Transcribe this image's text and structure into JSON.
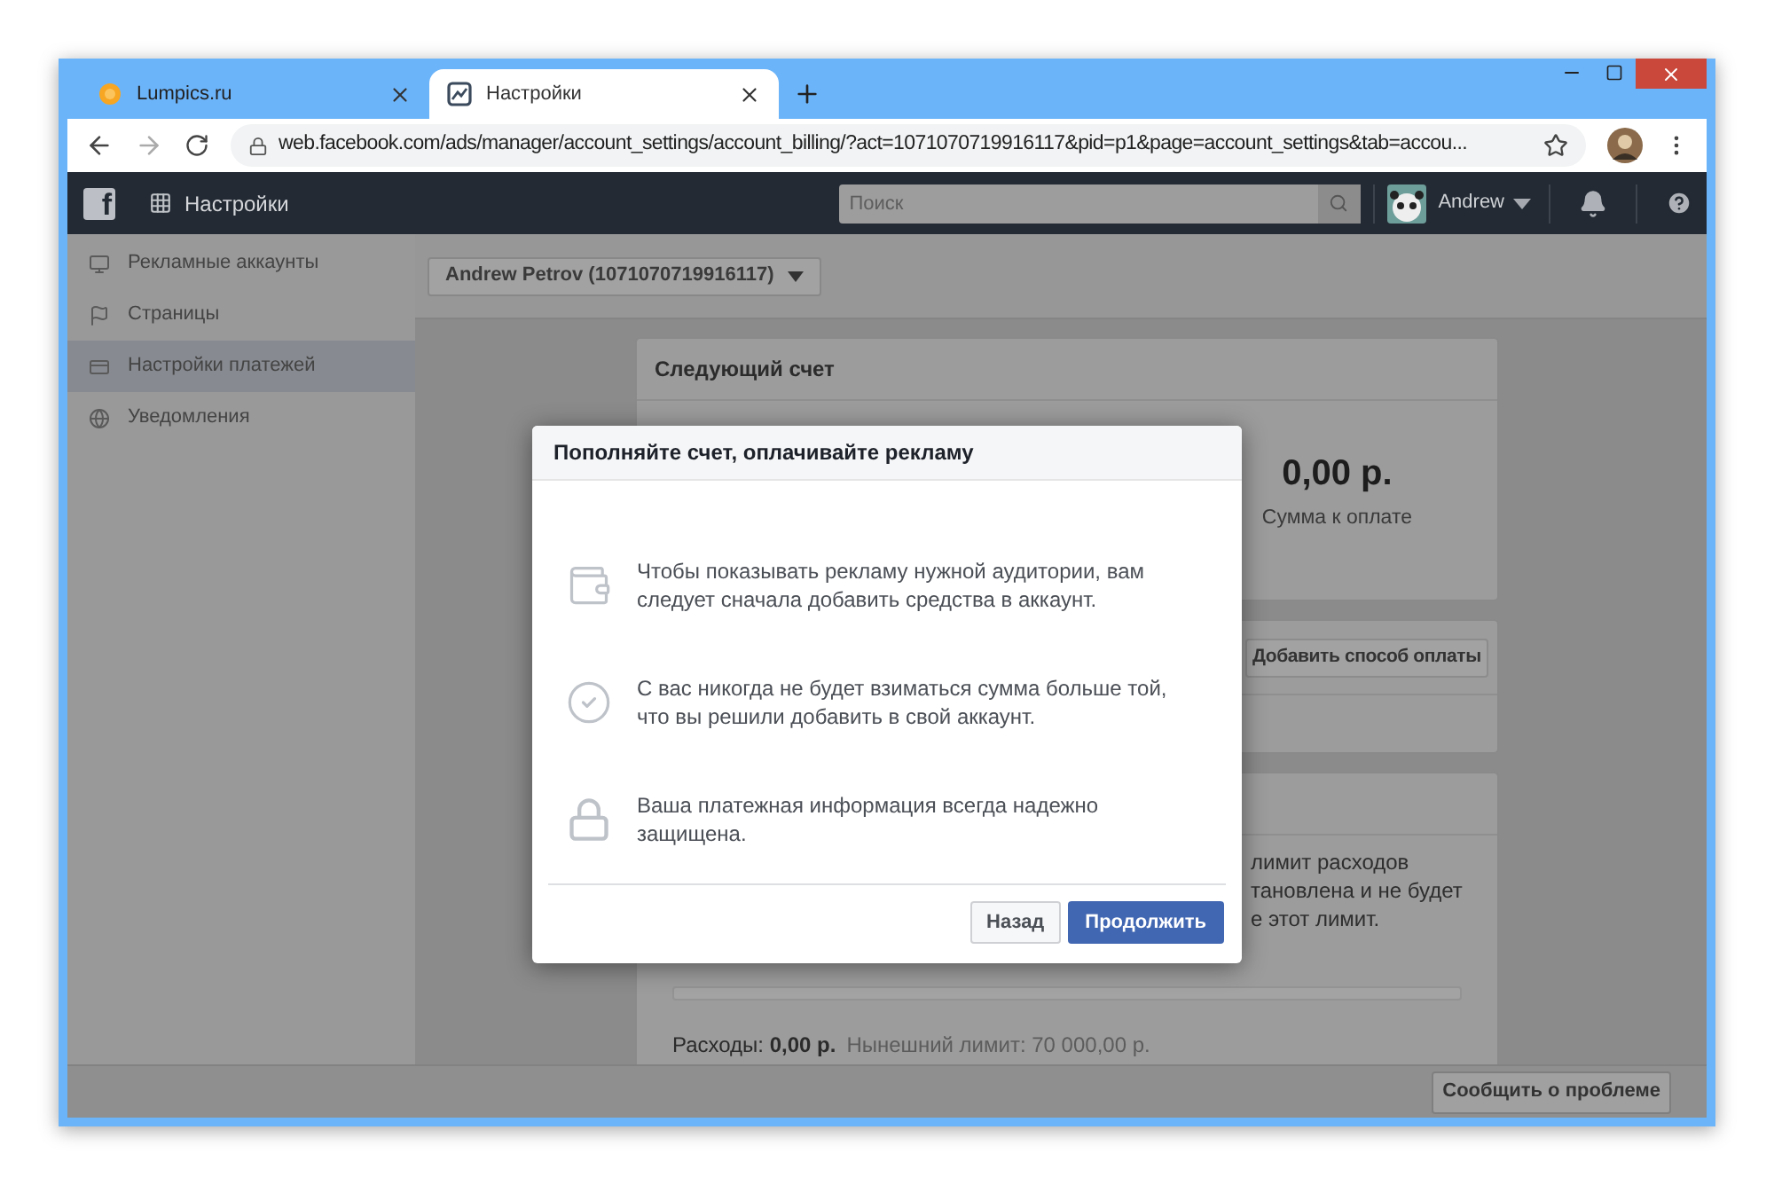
{
  "browser": {
    "tabs": [
      {
        "title": "Lumpics.ru",
        "selected": false
      },
      {
        "title": "Настройки",
        "selected": true
      }
    ],
    "url": "web.facebook.com/ads/manager/account_settings/account_billing/?act=1071070719916117&pid=p1&page=account_settings&tab=accou..."
  },
  "topbar": {
    "logo": "f",
    "title": "Настройки",
    "search_placeholder": "Поиск",
    "user": "Andrew"
  },
  "sidebar": [
    {
      "label": "Рекламные аккаунты",
      "kind": "accounts",
      "selected": false
    },
    {
      "label": "Страницы",
      "kind": "pages",
      "selected": false
    },
    {
      "label": "Настройки платежей",
      "kind": "payments",
      "selected": true
    },
    {
      "label": "Уведомления",
      "kind": "notifications",
      "selected": false
    }
  ],
  "account_selector": "Andrew Petrov (1071070719916117)",
  "next_bill": {
    "title": "Следующий счет",
    "amount": "0,00 р.",
    "amount_label": "Сумма к оплате"
  },
  "add_payment_button": "Добавить способ оплаты",
  "limit_card": {
    "text_lines": [
      "лимит расходов",
      "тановлена и не будет",
      "е этот лимит."
    ],
    "level": 0,
    "spent": "Расходы: **0,00 р.**",
    "limit": "Нынешний лимит: 70 000,00 р."
  },
  "modal": {
    "title": "Пополняйте счет, оплачивайте рекламу",
    "items": [
      {
        "kind": "wallet",
        "text": "Чтобы показывать рекламу нужной аудитории, вам следует сначала добавить средства в аккаунт."
      },
      {
        "kind": "check",
        "text": "С вас никогда не будет взиматься сумма больше той, что вы решили добавить в свой аккаунт."
      },
      {
        "kind": "lock",
        "text": "Ваша платежная информация всегда надежно защищена."
      }
    ],
    "buttons": [
      {
        "label": "Назад",
        "kind": "secondary"
      },
      {
        "label": "Продолжить",
        "kind": "primary"
      }
    ]
  },
  "report_button": "Сообщить о проблеме"
}
